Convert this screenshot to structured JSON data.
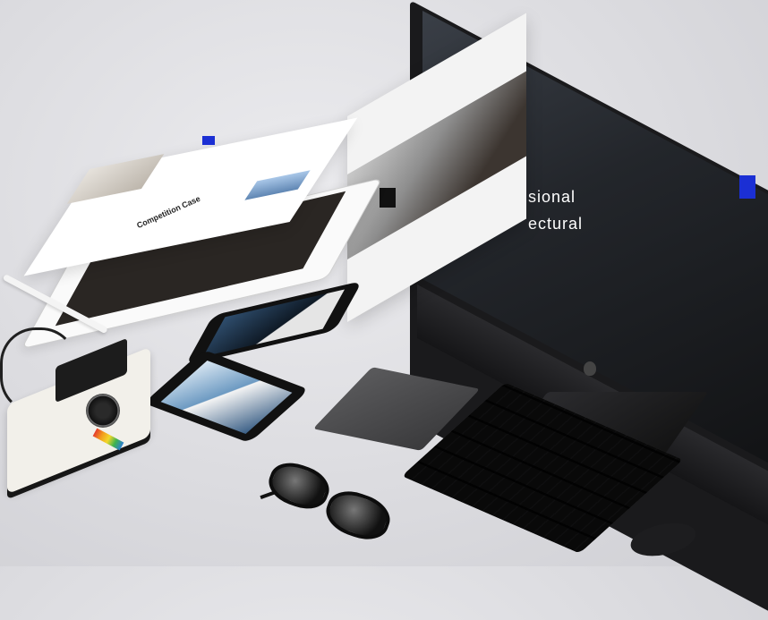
{
  "scene": {
    "imac_screen": {
      "headline_line_1": "sional",
      "headline_line_2": "ectural"
    },
    "ipad_float_page": {
      "title": "Competition Case"
    },
    "icons": [
      "apple-logo-icon"
    ]
  }
}
